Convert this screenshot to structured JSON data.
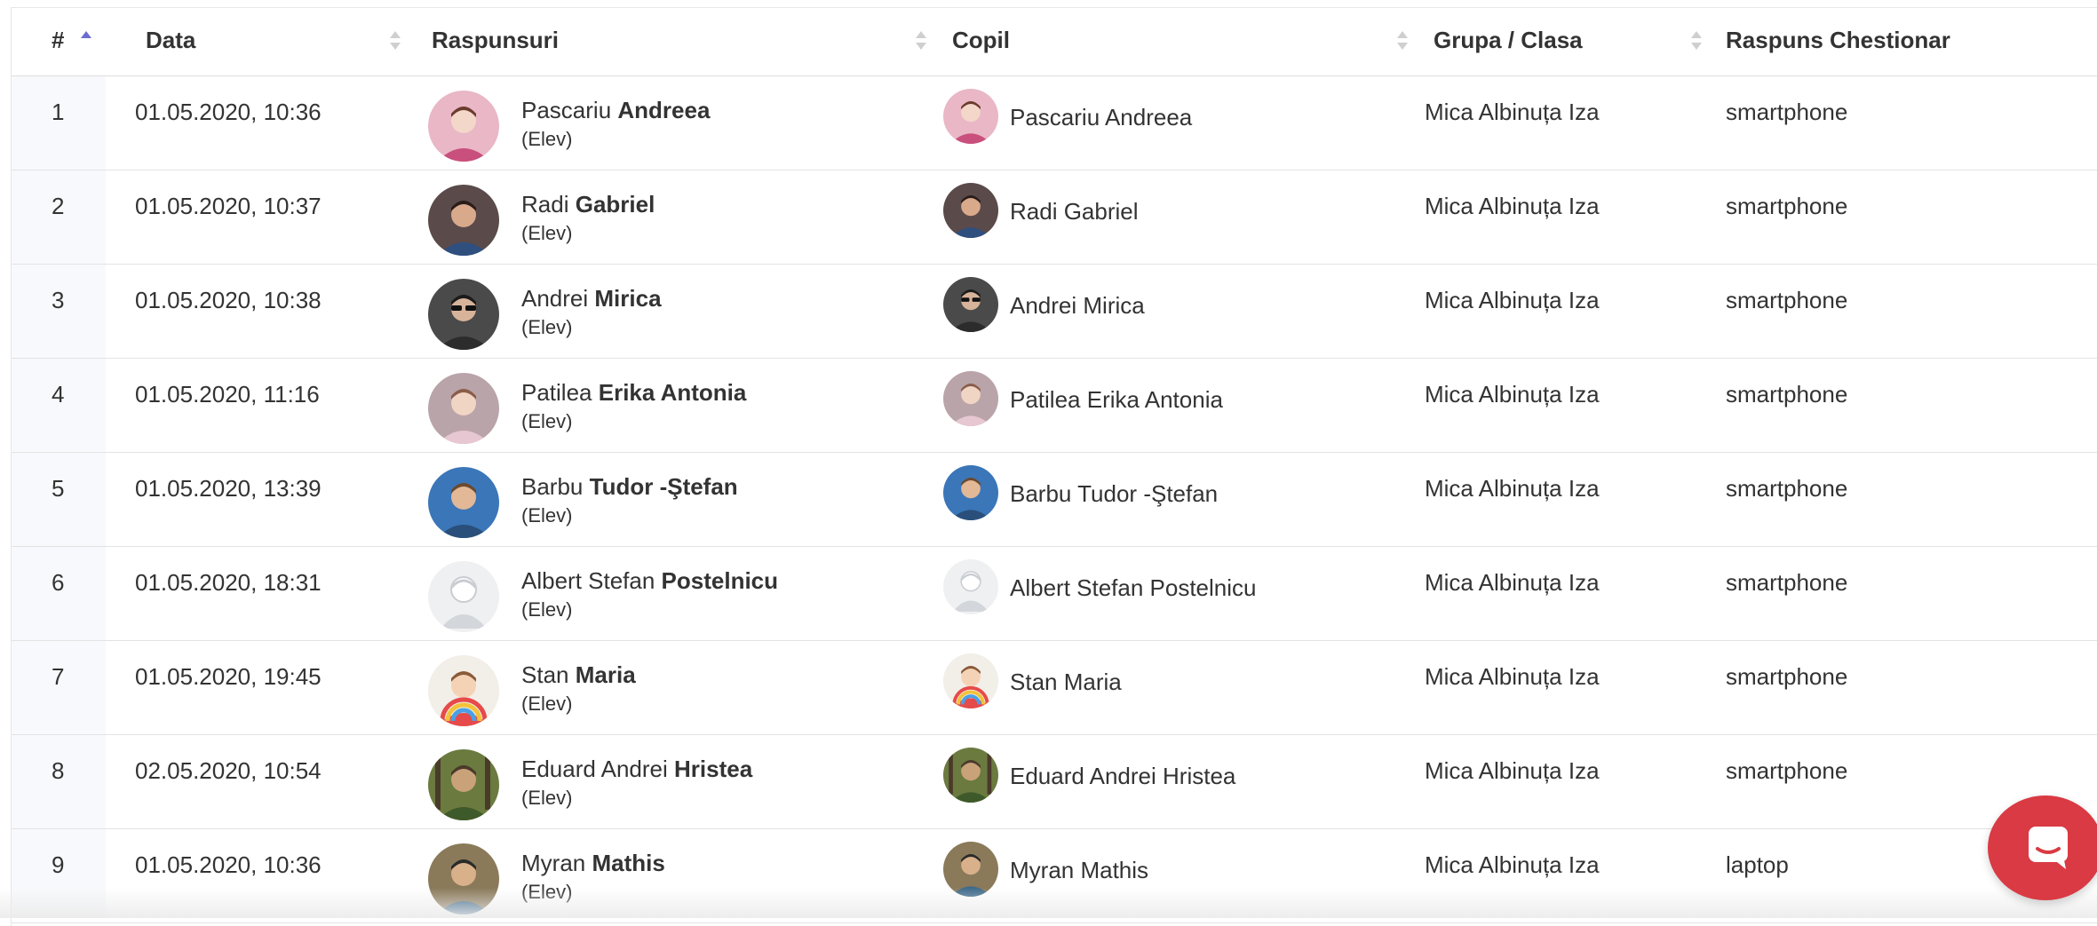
{
  "table": {
    "headers": [
      {
        "label": "#"
      },
      {
        "label": "Data"
      },
      {
        "label": "Raspunsuri"
      },
      {
        "label": "Copil"
      },
      {
        "label": "Grupa / Clasa"
      },
      {
        "label": "Raspuns Chestionar"
      }
    ],
    "rows": [
      {
        "index": "1",
        "date": "01.05.2020, 10:36",
        "first": "Pascariu",
        "last": "Andreea",
        "role": "(Elev)",
        "child": "Pascariu Andreea",
        "group": "Mica Albinuța Iza",
        "answer": "smartphone",
        "avatar": "photo-girl-pink"
      },
      {
        "index": "2",
        "date": "01.05.2020, 10:37",
        "first": "Radi",
        "last": "Gabriel",
        "role": "(Elev)",
        "child": "Radi Gabriel",
        "group": "Mica Albinuța Iza",
        "answer": "smartphone",
        "avatar": "photo-boy-dark"
      },
      {
        "index": "3",
        "date": "01.05.2020, 10:38",
        "first": "Andrei",
        "last": "Mirica",
        "role": "(Elev)",
        "child": "Andrei Mirica",
        "group": "Mica Albinuța Iza",
        "answer": "smartphone",
        "avatar": "photo-boy-sunglasses"
      },
      {
        "index": "4",
        "date": "01.05.2020, 11:16",
        "first": "Patilea",
        "last": "Erika Antonia",
        "role": "(Elev)",
        "child": "Patilea Erika Antonia",
        "group": "Mica Albinuța Iza",
        "answer": "smartphone",
        "avatar": "photo-girl-dress"
      },
      {
        "index": "5",
        "date": "01.05.2020, 13:39",
        "first": "Barbu",
        "last": "Tudor -Ştefan",
        "role": "(Elev)",
        "child": "Barbu Tudor -Ştefan",
        "group": "Mica Albinuța Iza",
        "answer": "smartphone",
        "avatar": "photo-boy-pool"
      },
      {
        "index": "6",
        "date": "01.05.2020, 18:31",
        "first": "Albert Stefan",
        "last": "Postelnicu",
        "role": "(Elev)",
        "child": "Albert Stefan Postelnicu",
        "group": "Mica Albinuța Iza",
        "answer": "smartphone",
        "avatar": "default-user"
      },
      {
        "index": "7",
        "date": "01.05.2020, 19:45",
        "first": "Stan",
        "last": "Maria",
        "role": "(Elev)",
        "child": "Stan Maria",
        "group": "Mica Albinuța Iza",
        "answer": "smartphone",
        "avatar": "photo-girl-rainbow"
      },
      {
        "index": "8",
        "date": "02.05.2020, 10:54",
        "first": "Eduard Andrei",
        "last": "Hristea",
        "role": "(Elev)",
        "child": "Eduard Andrei Hristea",
        "group": "Mica Albinuța Iza",
        "answer": "smartphone",
        "avatar": "photo-boy-park"
      },
      {
        "index": "9",
        "date": "01.05.2020, 10:36",
        "first": "Myran",
        "last": "Mathis",
        "role": "(Elev)",
        "child": "Myran Mathis",
        "group": "Mica Albinuța Iza",
        "answer": "laptop",
        "avatar": "photo-boy-outdoor"
      }
    ]
  },
  "chat": {
    "icon": "chat-bubble-icon"
  },
  "colors": {
    "sort_active": "#6c6ccf",
    "sort_inactive": "#cfcfcf",
    "chat_fab": "#d93a43",
    "index_column_bg": "#f8f9fc"
  }
}
